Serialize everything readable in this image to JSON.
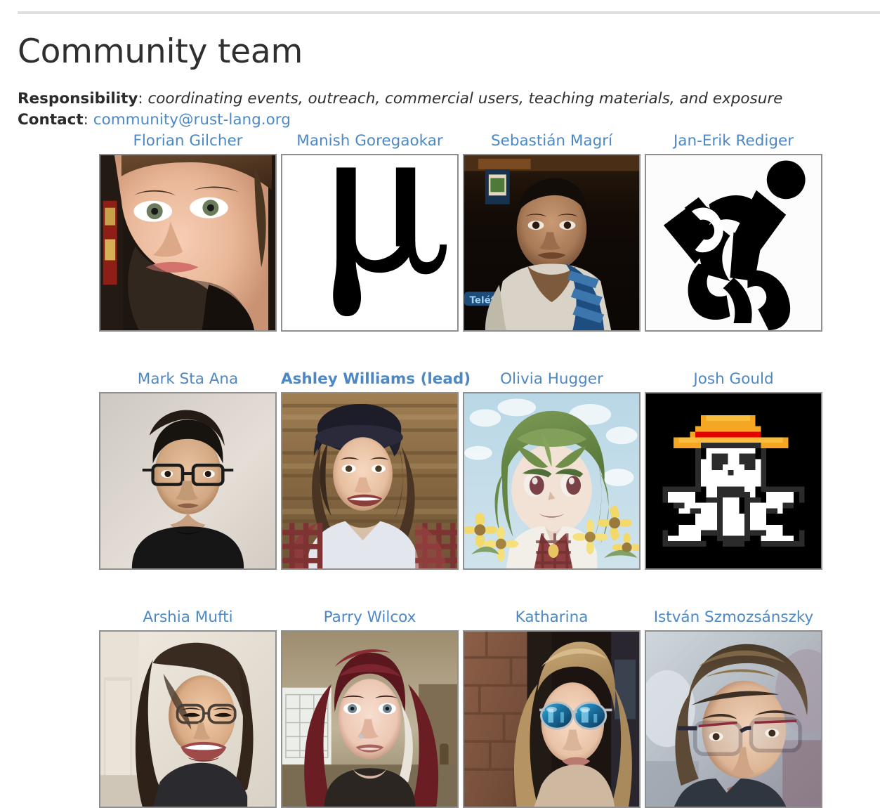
{
  "page": {
    "title": "Community team"
  },
  "meta": {
    "responsibility_label": "Responsibility",
    "responsibility_sep": ": ",
    "responsibility_text": "coordinating events, outreach, commercial users, teaching materials, and exposure",
    "contact_label": "Contact",
    "contact_sep": ": ",
    "contact_email": "community@rust-lang.org"
  },
  "colors": {
    "link": "#4d88c4",
    "text": "#2f2f2f",
    "rule": "#e0e0e0",
    "avatar_border": "#8f8f8f"
  },
  "members": [
    {
      "name": "Florian Gilcher",
      "lead": false,
      "avatar": "photo-portrait-man-beard"
    },
    {
      "name": "Manish Goregaokar",
      "lead": false,
      "avatar": "mu-glyph-icon"
    },
    {
      "name": "Sebastián Magrí",
      "lead": false,
      "avatar": "photo-portrait-man-scarf"
    },
    {
      "name": "Jan-Erik Rediger",
      "lead": false,
      "avatar": "running-person-briefcase-icon"
    },
    {
      "name": "Mark Sta Ana",
      "lead": false,
      "avatar": "photo-portrait-man-glasses"
    },
    {
      "name": "Ashley Williams (lead)",
      "lead": true,
      "avatar": "photo-portrait-woman-beanie"
    },
    {
      "name": "Olivia Hugger",
      "lead": false,
      "avatar": "anime-green-hair-sunflowers"
    },
    {
      "name": "Josh Gould",
      "lead": false,
      "avatar": "pixel-skull-strawhat-icon"
    },
    {
      "name": "Arshia Mufti",
      "lead": false,
      "avatar": "photo-portrait-woman-glasses"
    },
    {
      "name": "Parry Wilcox",
      "lead": false,
      "avatar": "photo-portrait-woman-redhair"
    },
    {
      "name": "Katharina",
      "lead": false,
      "avatar": "photo-portrait-woman-sunglasses"
    },
    {
      "name": "István Szmozsánszky",
      "lead": false,
      "avatar": "photo-portrait-man-glasses-2"
    }
  ]
}
